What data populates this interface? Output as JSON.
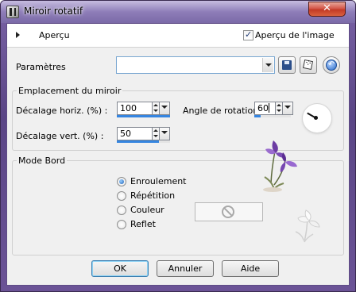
{
  "window": {
    "title": "Miroir rotatif",
    "close_label": "✕"
  },
  "preview": {
    "toggle_label": "Aperçu",
    "image_preview_label": "Aperçu de l'image",
    "image_preview_checked": true
  },
  "params": {
    "label": "Paramètres",
    "preset_value": ""
  },
  "mirror_group": {
    "title": "Emplacement du miroir",
    "h_offset_label": "Décalage horiz. (%) :",
    "h_offset_value": "100",
    "v_offset_label": "Décalage vert. (%) :",
    "v_offset_value": "50",
    "rotation_label": "Angle de rotation :",
    "rotation_value": "60"
  },
  "edge_group": {
    "title": "Mode Bord",
    "options": [
      "Enroulement",
      "Répétition",
      "Couleur",
      "Reflet"
    ],
    "selected": "Enroulement"
  },
  "buttons": {
    "ok": "OK",
    "cancel": "Annuler",
    "help": "Aide"
  },
  "colors": {
    "title_bar": "#7b6aa8",
    "accent": "#3585e0",
    "close": "#c33a26"
  }
}
